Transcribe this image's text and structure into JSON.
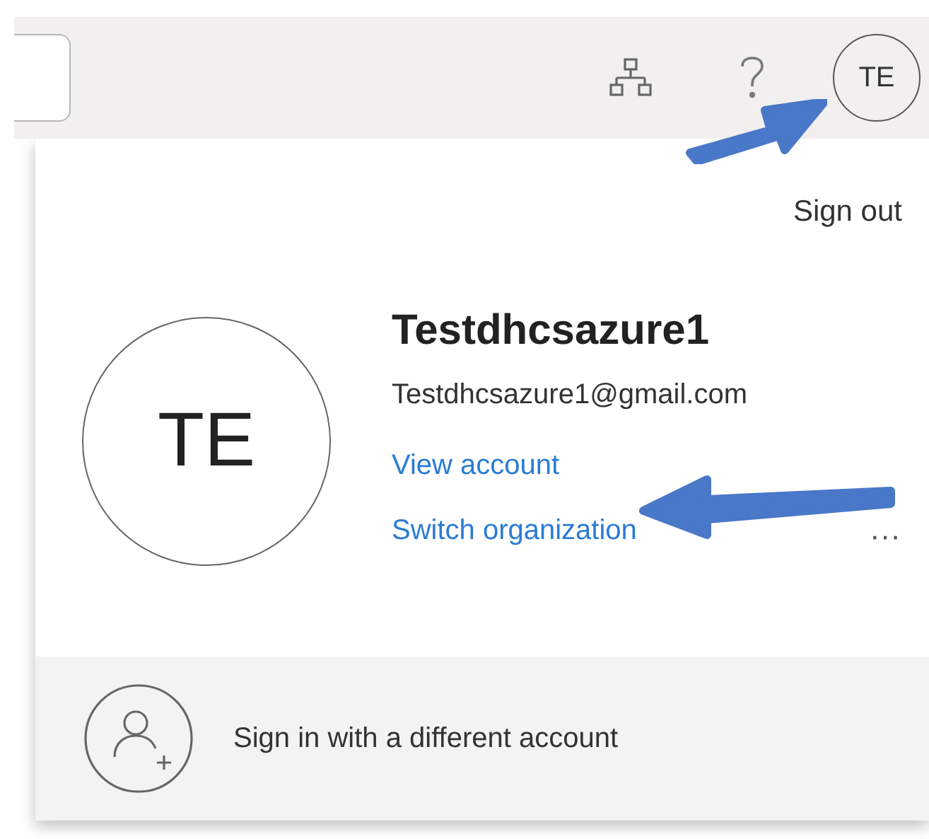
{
  "header": {
    "avatar_initials": "TE"
  },
  "account_panel": {
    "sign_out": "Sign out",
    "avatar_initials": "TE",
    "name": "Testdhcsazure1",
    "email": "Testdhcsazure1@gmail.com",
    "links": [
      {
        "label": "View account"
      },
      {
        "label": "Switch organization"
      }
    ],
    "more": "···",
    "other_account": "Sign in with a different account"
  }
}
